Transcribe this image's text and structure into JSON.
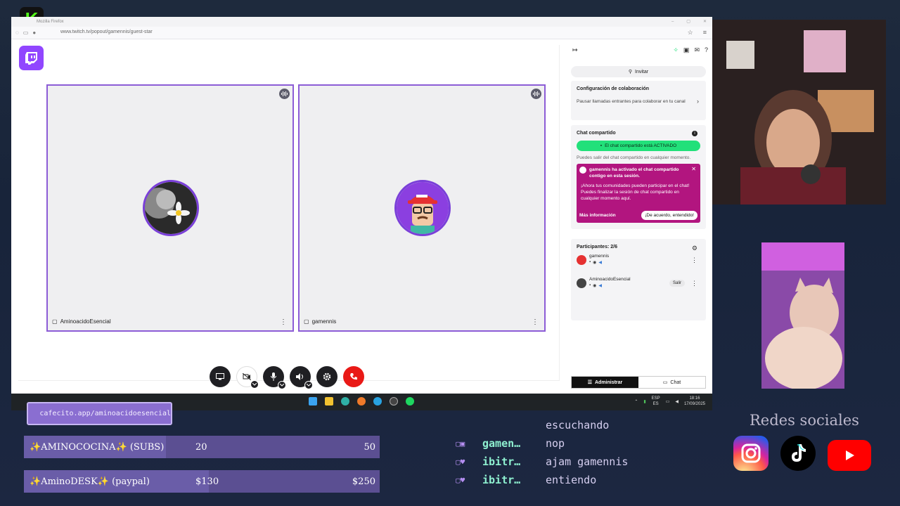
{
  "browser": {
    "window_title": "Mozilla Firefox",
    "url": "www.twitch.tv/popout/gamennis/guest-star"
  },
  "stage": {
    "tiles": [
      {
        "name": "AminoacidoEsencial"
      },
      {
        "name": "gamennis"
      }
    ]
  },
  "panel": {
    "invite_label": "Invitar",
    "collab": {
      "title": "Configuración de colaboración",
      "text": "Pausar llamadas entrantes para colaborar en tu canal"
    },
    "shared_chat": {
      "title": "Chat compartido",
      "status": "El chat compartido está ACTIVADO",
      "note": "Puedes salir del chat compartido en cualquier momento.",
      "alert_header": "gamennis ha activado el chat compartido contigo en esta sesión.",
      "alert_body": "¡Ahora tus comunidades pueden participar en el chat! Puedes finalizar la sesión de chat compartido en cualquier momento aquí.",
      "more_info": "Más información",
      "ok_button": "¡De acuerdo, entendido!"
    },
    "participants": {
      "title": "Participantes: 2/6",
      "list": [
        {
          "name": "gamennis"
        },
        {
          "name": "AminoacidoEsencial",
          "action": "Salir"
        }
      ]
    },
    "tabs": {
      "admin": "Administrar",
      "chat": "Chat"
    }
  },
  "taskbar": {
    "lang_top": "ESP",
    "lang_bottom": "ES",
    "time": "18:16",
    "date": "17/09/2025"
  },
  "overlay": {
    "cafecito": "cafecito.app/aminoacidoesencial",
    "goals": [
      {
        "label": "✨AMINOCOCINA✨ (SUBS)",
        "current": "20",
        "max": "50",
        "progress": 0.4
      },
      {
        "label": "✨AminoDESK✨ (paypal)",
        "current": "$130",
        "max": "$250",
        "progress": 0.52
      }
    ],
    "chat": [
      {
        "user": "",
        "msg": "escuchando"
      },
      {
        "user": "gamen…",
        "msg": "nop"
      },
      {
        "user": "ibitr…",
        "msg": "ajam gamennis"
      },
      {
        "user": "ibitr…",
        "msg": "entiendo"
      }
    ],
    "social_title": "Redes sociales"
  },
  "colors": {
    "twitch_purple": "#9146ff",
    "kick_green": "#53fc18",
    "shared_green": "#22e07a",
    "alert_magenta": "#b2157f",
    "end_call_red": "#e91916"
  },
  "icons": [
    "twitch-icon",
    "kick-icon",
    "screen-share-icon",
    "camera-off-icon",
    "mic-icon",
    "speaker-icon",
    "gear-icon",
    "phone-end-icon",
    "instagram-icon",
    "tiktok-icon",
    "youtube-icon"
  ]
}
